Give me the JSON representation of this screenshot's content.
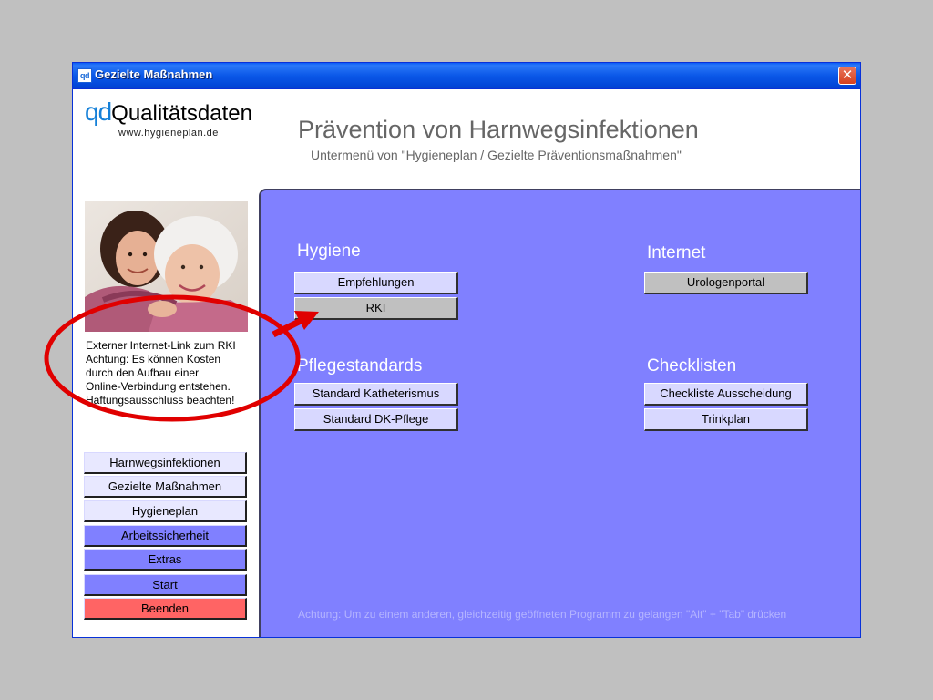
{
  "window": {
    "title": "Gezielte Maßnahmen",
    "icon_text": "qd",
    "close_symbol": "✕"
  },
  "logo": {
    "prefix": "qd",
    "name": "Qualitätsdaten",
    "url": "www.hygieneplan.de"
  },
  "header": {
    "title": "Prävention von Harnwegsinfektionen",
    "subtitle": "Untermenü von \"Hygieneplan / Gezielte Präventionsmaßnahmen\""
  },
  "notice": {
    "lines": [
      "Externer Internet-Link zum RKI",
      "Achtung: Es können Kosten",
      "durch den Aufbau einer",
      "Online-Verbindung entstehen.",
      "Haftungsausschluss beachten!"
    ]
  },
  "sidebar": {
    "items": [
      {
        "label": "Harnwegsinfektionen",
        "style": "light"
      },
      {
        "label": "Gezielte Maßnahmen",
        "style": "light"
      },
      {
        "label": "Hygieneplan",
        "style": "light"
      },
      {
        "label": "Arbeitssicherheit",
        "style": "dark"
      },
      {
        "label": "Extras",
        "style": "dark"
      },
      {
        "label": "Start",
        "style": "dark"
      },
      {
        "label": "Beenden",
        "style": "red"
      }
    ]
  },
  "sections": {
    "hygiene": {
      "title": "Hygiene",
      "buttons": [
        {
          "label": "Empfehlungen"
        },
        {
          "label": "RKI"
        }
      ]
    },
    "internet": {
      "title": "Internet",
      "buttons": [
        {
          "label": "Urologenportal"
        }
      ]
    },
    "pflege": {
      "title": "Pflegestandards",
      "buttons": [
        {
          "label": "Standard Katheterismus"
        },
        {
          "label": "Standard DK-Pflege"
        }
      ]
    },
    "checklisten": {
      "title": "Checklisten",
      "buttons": [
        {
          "label": "Checkliste Ausscheidung"
        },
        {
          "label": "Trinkplan"
        }
      ]
    }
  },
  "footnote": "Achtung: Um zu einem anderen, gleichzeitig geöffneten Programm zu gelangen \"Alt\" + \"Tab\" drücken",
  "colors": {
    "panel": "#8080ff",
    "annotation": "#e00000",
    "logo_accent": "#1580d8"
  }
}
